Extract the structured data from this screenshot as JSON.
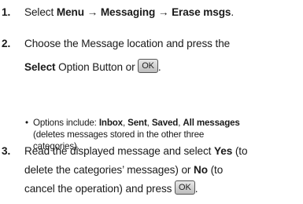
{
  "steps": [
    {
      "number": "1.",
      "text_prefix": "Select ",
      "menu": "Menu",
      "arrow1": "→",
      "messaging": "Messaging",
      "arrow2": "→",
      "erase": "Erase msgs",
      "suffix": "."
    },
    {
      "number": "2.",
      "line1": "Choose the Message location and press the",
      "select_label": "Select",
      "line2_mid": " Option Button or ",
      "end": "."
    },
    {
      "number": "3.",
      "line1_a": "Read the displayed message and select ",
      "yes": "Yes",
      "line1_b": " (to",
      "line2_a": "delete the categories’ messages) or ",
      "no": "No",
      "line2_b": " (to",
      "line3": "cancel the operation) and press ",
      "end": "."
    }
  ],
  "bullet": {
    "dot": "•",
    "intro": "Options include: ",
    "inbox": "Inbox",
    "sep1": ", ",
    "sent": "Sent",
    "sep2": ", ",
    "saved": "Saved",
    "sep3": ", ",
    "all": "All messages",
    "line2": "(deletes messages stored in the other three",
    "line3": "categories)."
  },
  "ok_button_label": "OK"
}
